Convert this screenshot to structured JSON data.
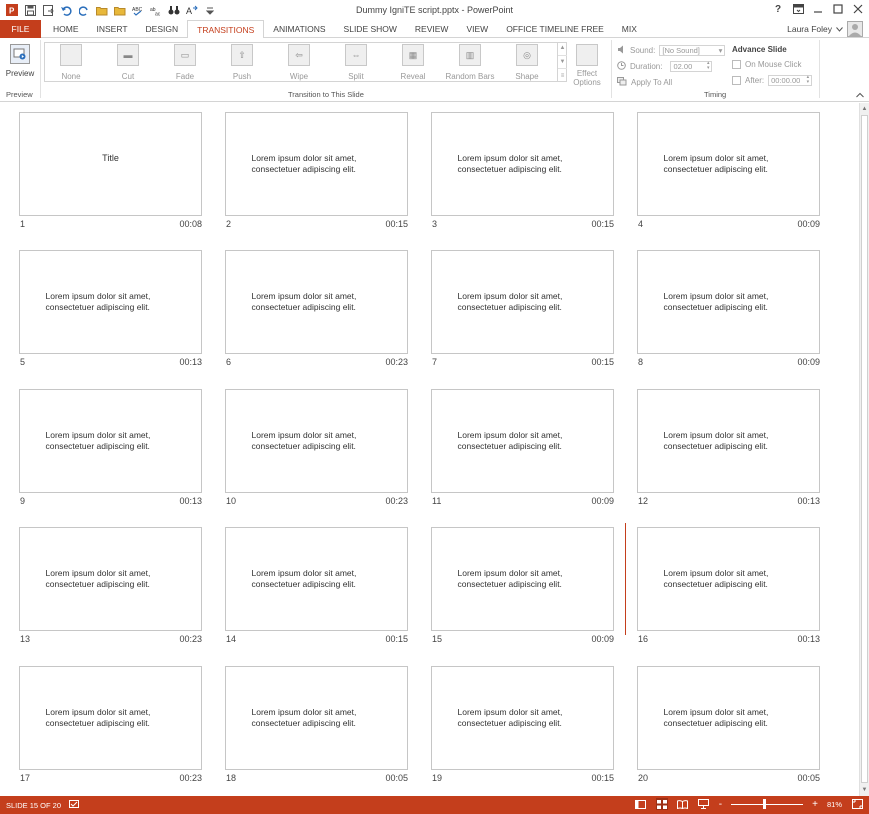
{
  "window": {
    "title": "Dummy IgniTE script.pptx - PowerPoint",
    "help": "?",
    "user": "Laura Foley"
  },
  "tabs": {
    "file": "FILE",
    "items": [
      "HOME",
      "INSERT",
      "DESIGN",
      "TRANSITIONS",
      "ANIMATIONS",
      "SLIDE SHOW",
      "REVIEW",
      "VIEW",
      "OFFICE TIMELINE FREE",
      "MIX"
    ],
    "active": "TRANSITIONS"
  },
  "ribbon": {
    "preview": {
      "label": "Preview",
      "group": "Preview"
    },
    "transitions": {
      "items": [
        "None",
        "Cut",
        "Fade",
        "Push",
        "Wipe",
        "Split",
        "Reveal",
        "Random Bars",
        "Shape"
      ],
      "group": "Transition to This Slide",
      "effect_options": "Effect Options",
      "effect_options_line1": "Effect",
      "effect_options_line2": "Options"
    },
    "timing": {
      "group": "Timing",
      "sound_label": "Sound:",
      "sound_value": "[No Sound]",
      "duration_label": "Duration:",
      "duration_value": "02.00",
      "apply_all": "Apply To All",
      "advance_title": "Advance Slide",
      "on_mouse_click": "On Mouse Click",
      "after_label": "After:",
      "after_value": "00:00.00"
    }
  },
  "slides": [
    {
      "num": "1",
      "time": "00:08",
      "text": "Title"
    },
    {
      "num": "2",
      "time": "00:15",
      "text": "Lorem ipsum dolor sit amet, consectetuer adipiscing elit."
    },
    {
      "num": "3",
      "time": "00:15",
      "text": "Lorem ipsum dolor sit amet, consectetuer adipiscing elit."
    },
    {
      "num": "4",
      "time": "00:09",
      "text": "Lorem ipsum dolor sit amet, consectetuer adipiscing elit."
    },
    {
      "num": "5",
      "time": "00:13",
      "text": "Lorem ipsum dolor sit amet, consectetuer adipiscing elit."
    },
    {
      "num": "6",
      "time": "00:23",
      "text": "Lorem ipsum dolor sit amet, consectetuer adipiscing elit."
    },
    {
      "num": "7",
      "time": "00:15",
      "text": "Lorem ipsum dolor sit amet, consectetuer adipiscing elit."
    },
    {
      "num": "8",
      "time": "00:09",
      "text": "Lorem ipsum dolor sit amet, consectetuer adipiscing elit."
    },
    {
      "num": "9",
      "time": "00:13",
      "text": "Lorem ipsum dolor sit amet, consectetuer adipiscing elit."
    },
    {
      "num": "10",
      "time": "00:23",
      "text": "Lorem ipsum dolor sit amet, consectetuer adipiscing elit."
    },
    {
      "num": "11",
      "time": "00:09",
      "text": "Lorem ipsum dolor sit amet, consectetuer adipiscing elit."
    },
    {
      "num": "12",
      "time": "00:13",
      "text": "Lorem ipsum dolor sit amet, consectetuer adipiscing elit."
    },
    {
      "num": "13",
      "time": "00:23",
      "text": "Lorem ipsum dolor sit amet, consectetuer adipiscing elit."
    },
    {
      "num": "14",
      "time": "00:15",
      "text": "Lorem ipsum dolor sit amet, consectetuer adipiscing elit."
    },
    {
      "num": "15",
      "time": "00:09",
      "text": "Lorem ipsum dolor sit amet, consectetuer adipiscing elit."
    },
    {
      "num": "16",
      "time": "00:13",
      "text": "Lorem ipsum dolor sit amet, consectetuer adipiscing elit."
    },
    {
      "num": "17",
      "time": "00:23",
      "text": "Lorem ipsum dolor sit amet, consectetuer adipiscing elit."
    },
    {
      "num": "18",
      "time": "00:05",
      "text": "Lorem ipsum dolor sit amet, consectetuer adipiscing elit."
    },
    {
      "num": "19",
      "time": "00:15",
      "text": "Lorem ipsum dolor sit amet, consectetuer adipiscing elit."
    },
    {
      "num": "20",
      "time": "00:05",
      "text": "Lorem ipsum dolor sit amet, consectetuer adipiscing elit."
    }
  ],
  "status": {
    "slide_info": "SLIDE 15 OF 20",
    "zoom": "81%",
    "zoom_minus": "-",
    "zoom_plus": "+"
  },
  "colors": {
    "accent": "#c43e1c",
    "status_bar": "#c43e1c",
    "slide_border": "#c6c6c6"
  }
}
